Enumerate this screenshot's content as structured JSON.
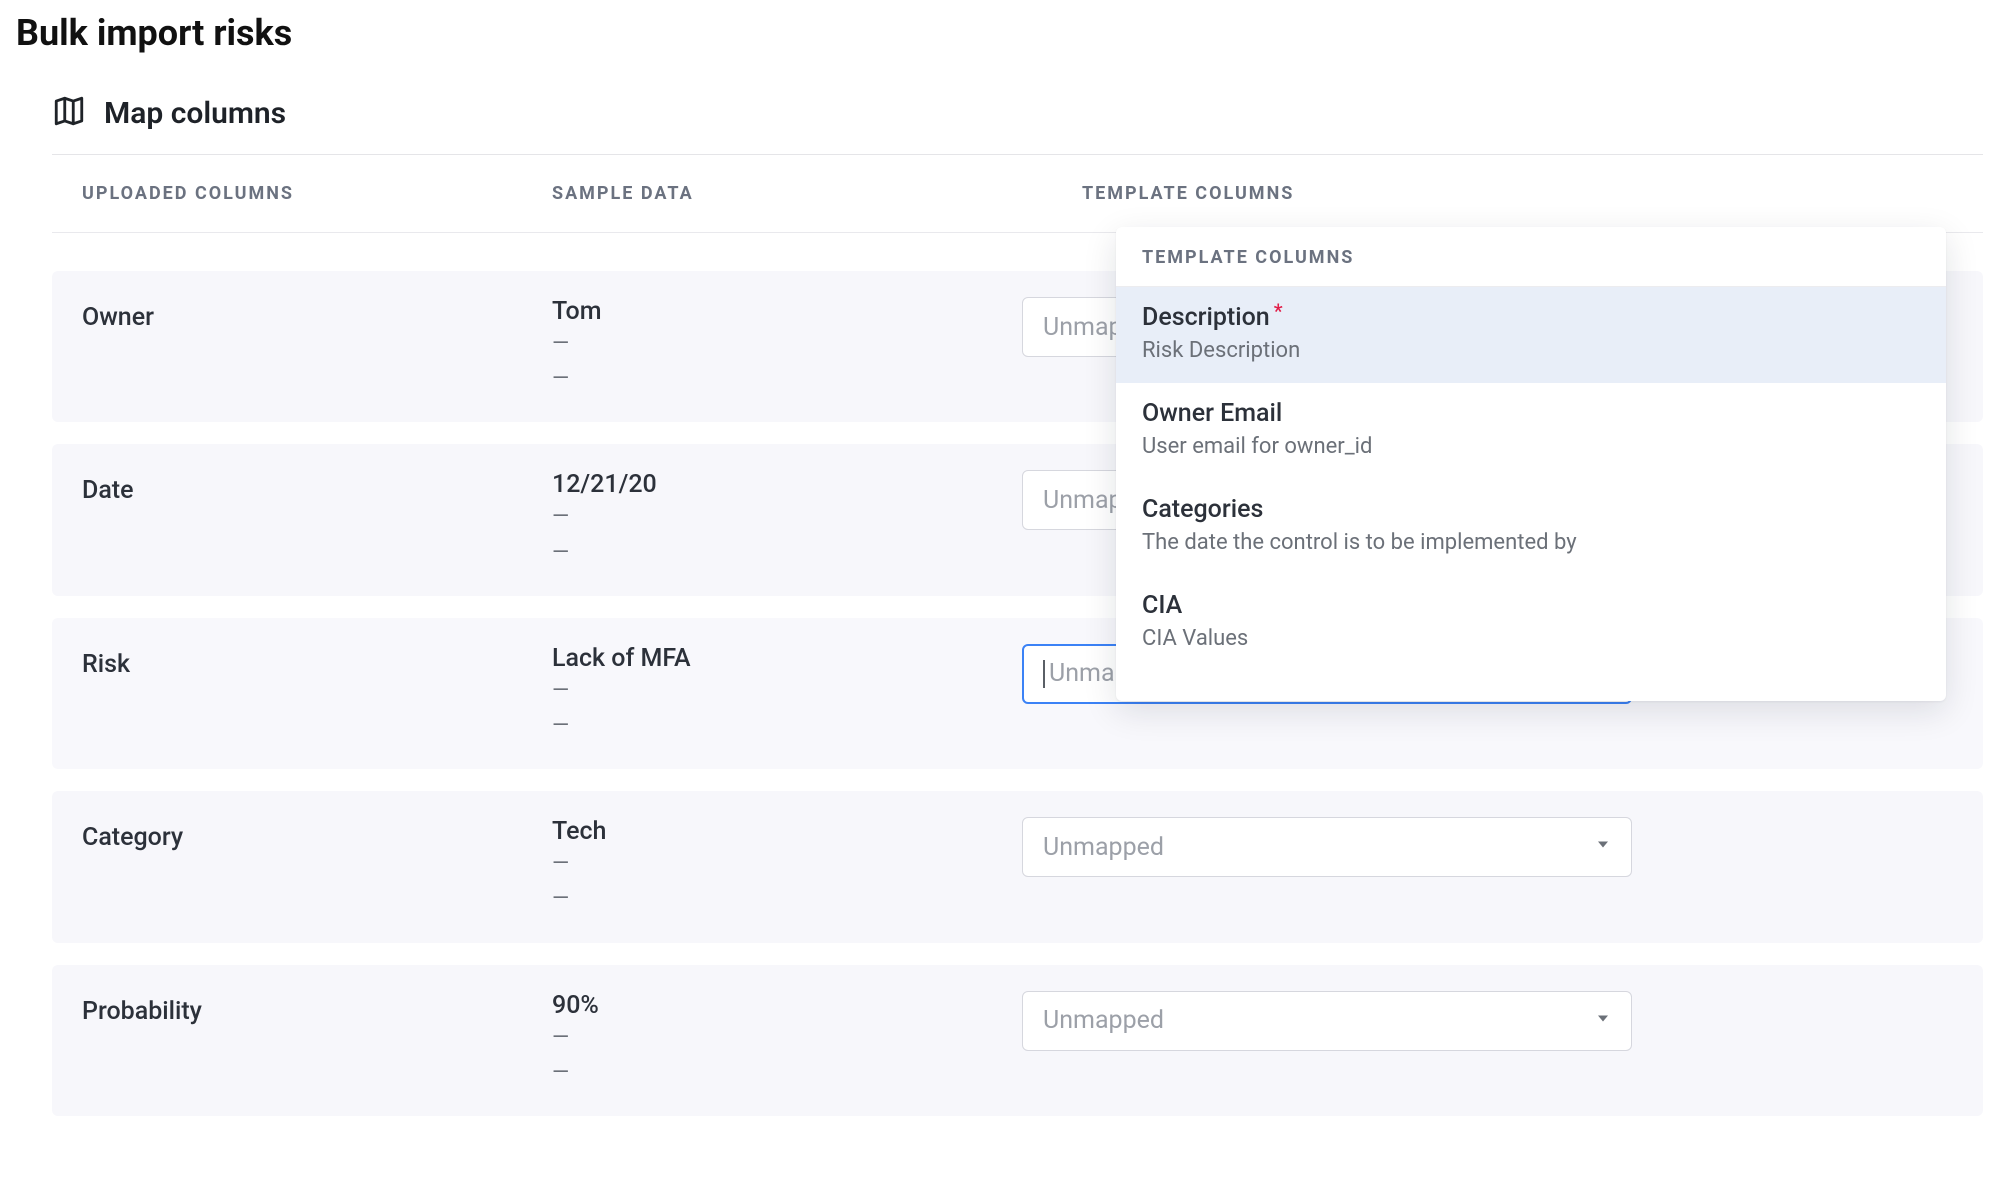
{
  "page_title": "Bulk import risks",
  "section_title": "Map columns",
  "headers": {
    "uploaded": "UPLOADED COLUMNS",
    "sample": "SAMPLE DATA",
    "template": "TEMPLATE COLUMNS"
  },
  "dash": "—",
  "select_placeholder": "Unmapped",
  "rows": [
    {
      "name": "Owner",
      "sample": "Tom",
      "focused": false
    },
    {
      "name": "Date",
      "sample": "12/21/20",
      "focused": false
    },
    {
      "name": "Risk",
      "sample": "Lack of MFA",
      "focused": true
    },
    {
      "name": "Category",
      "sample": "Tech",
      "focused": false
    },
    {
      "name": "Probability",
      "sample": "90%",
      "focused": false
    }
  ],
  "dropdown": {
    "header": "TEMPLATE COLUMNS",
    "options": [
      {
        "label": "Description",
        "required": true,
        "desc": "Risk Description",
        "highlight": true
      },
      {
        "label": "Owner Email",
        "required": false,
        "desc": "User email for owner_id",
        "highlight": false
      },
      {
        "label": "Categories",
        "required": false,
        "desc": "The date the control is to be implemented by",
        "highlight": false
      },
      {
        "label": "CIA",
        "required": false,
        "desc": "CIA Values",
        "highlight": false
      }
    ]
  }
}
